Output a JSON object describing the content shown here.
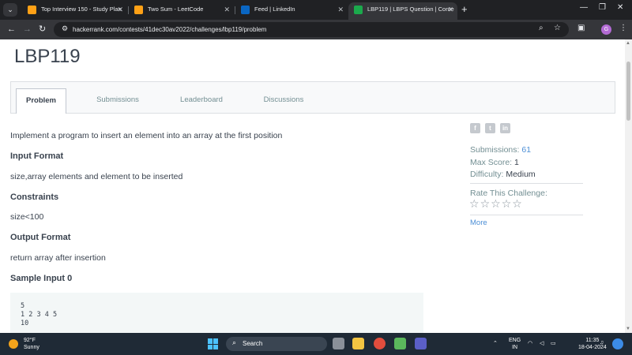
{
  "browser": {
    "tabs": [
      {
        "title": "Top Interview 150 - Study Plan",
        "favicon_color": "#ffa116",
        "active": false
      },
      {
        "title": "Two Sum - LeetCode",
        "favicon_color": "#ffa116",
        "active": false
      },
      {
        "title": "Feed | LinkedIn",
        "favicon_color": "#0a66c2",
        "active": false
      },
      {
        "title": "LBP119 | LBPS Question | Conte",
        "favicon_color": "#1ba94c",
        "active": true
      }
    ],
    "url": "hackerrank.com/contests/41dec30av2022/challenges/lbp119/problem",
    "profile_initial": "G"
  },
  "challenge": {
    "title": "LBP119",
    "tabs": [
      "Problem",
      "Submissions",
      "Leaderboard",
      "Discussions"
    ],
    "active_tab": "Problem",
    "statement": "Implement a program to insert an element into an array at the first position",
    "input_format_heading": "Input Format",
    "input_format": "size,array elements and element to be inserted",
    "constraints_heading": "Constraints",
    "constraints": "size<100",
    "output_format_heading": "Output Format",
    "output_format": "return array after insertion",
    "sample_input_heading": "Sample Input 0",
    "sample_input": "5\n1 2 3 4 5\n10"
  },
  "sidebar": {
    "submissions_label": "Submissions:",
    "submissions_value": "61",
    "max_score_label": "Max Score:",
    "max_score_value": "1",
    "difficulty_label": "Difficulty:",
    "difficulty_value": "Medium",
    "rate_label": "Rate This Challenge:",
    "rating": 0,
    "more_label": "More",
    "social_icons": [
      "facebook-icon",
      "twitter-icon",
      "linkedin-icon"
    ]
  },
  "taskbar": {
    "temperature": "92°F",
    "weather": "Sunny",
    "search_label": "Search",
    "language": "ENG",
    "region": "IN",
    "time": "11:35",
    "date": "18-04-2024"
  }
}
